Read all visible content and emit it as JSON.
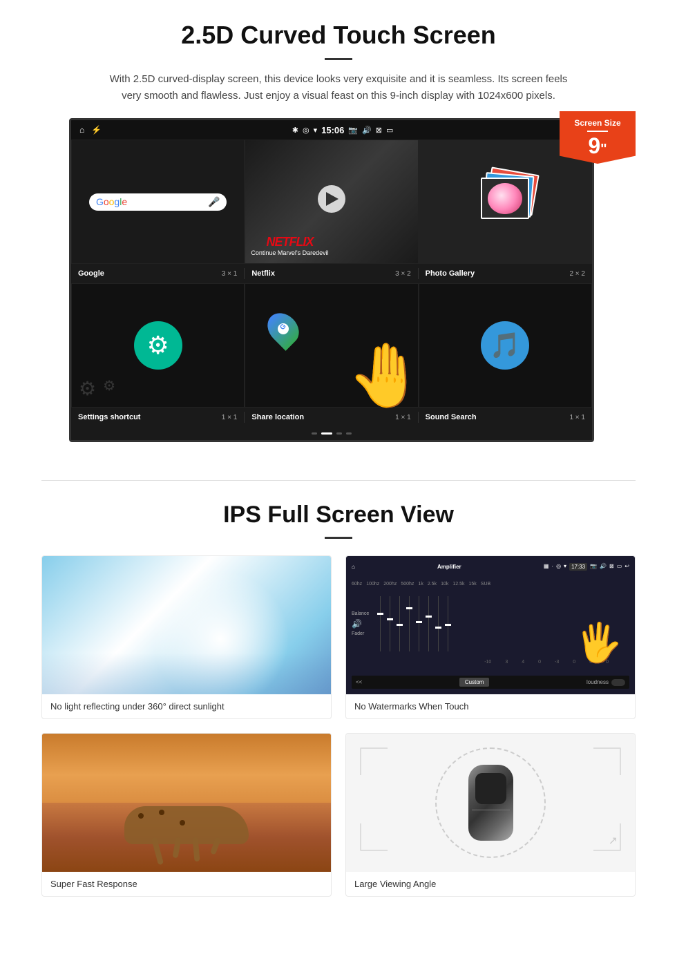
{
  "section1": {
    "title": "2.5D Curved Touch Screen",
    "description": "With 2.5D curved-display screen, this device looks very exquisite and it is seamless. Its screen feels very smooth and flawless. Just enjoy a visual feast on this 9-inch display with 1024x600 pixels.",
    "badge": {
      "title": "Screen Size",
      "size": "9",
      "unit": "\""
    },
    "status_bar": {
      "time": "15:06"
    },
    "apps": [
      {
        "name": "Google",
        "size": "3 × 1",
        "type": "google"
      },
      {
        "name": "Netflix",
        "size": "3 × 2",
        "type": "netflix",
        "netflix_text": "NETFLIX",
        "netflix_sub": "Continue Marvel's Daredevil"
      },
      {
        "name": "Photo Gallery",
        "size": "2 × 2",
        "type": "gallery"
      },
      {
        "name": "Settings shortcut",
        "size": "1 × 1",
        "type": "settings"
      },
      {
        "name": "Share location",
        "size": "1 × 1",
        "type": "maps"
      },
      {
        "name": "Sound Search",
        "size": "1 × 1",
        "type": "sound"
      }
    ]
  },
  "section2": {
    "title": "IPS Full Screen View",
    "features": [
      {
        "id": "sunlight",
        "caption": "No light reflecting under 360° direct sunlight"
      },
      {
        "id": "amplifier",
        "caption": "No Watermarks When Touch"
      },
      {
        "id": "cheetah",
        "caption": "Super Fast Response"
      },
      {
        "id": "car",
        "caption": "Large Viewing Angle"
      }
    ]
  }
}
